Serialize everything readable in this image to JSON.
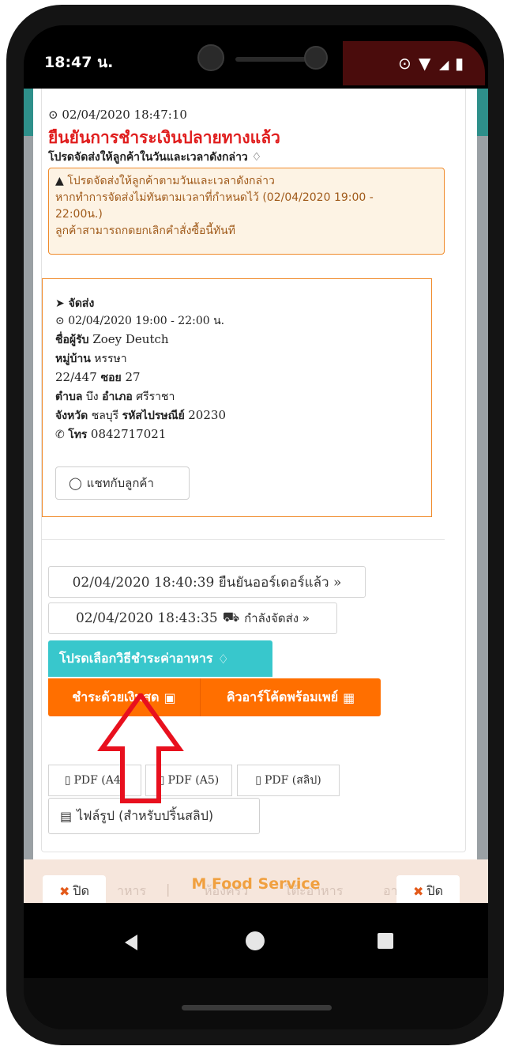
{
  "status_bar": {
    "time": "18:47 น.",
    "location_icon": "location-pin-icon",
    "wifi_icon": "wifi-icon",
    "signal_icon": "signal-icon",
    "battery_icon": "battery-icon"
  },
  "order": {
    "timestamp": "02/04/2020 18:47:10",
    "confirm_title": "ยืนยันการชำระเงินปลายทางแล้ว",
    "confirm_subtitle": "โปรดจัดส่งให้ลูกค้าในวันและเวลาดังกล่าว",
    "alert_line1": "โปรดจัดส่งให้ลูกค้าตามวันและเวลาดังกล่าว",
    "alert_line2": "หากทำการจัดส่งไม่ทันตามเวลาที่กำหนดไว้ (02/04/2020 19:00 -",
    "alert_line3": "22:00น.)",
    "alert_line4": "ลูกค้าสามารถกดยกเลิกคำสั่งซื้อนี้ทันที"
  },
  "delivery": {
    "heading": "จัดส่ง",
    "window": "02/04/2020 19:00 - 22:00 น.",
    "recipient_label": "ชื่อผู้รับ",
    "recipient": "Zoey Deutch",
    "village_label": "หมู่บ้าน",
    "village": "หรรษา",
    "house_no": "22/447",
    "soi_label": "ซอย",
    "soi": "27",
    "subdistrict_label": "ตำบล",
    "subdistrict": "บึง",
    "district_label": "อำเภอ",
    "district": "ศรีราชา",
    "province_label": "จังหวัด",
    "province": "ชลบุรี",
    "postcode_label": "รหัสไปรษณีย์",
    "postcode": "20230",
    "phone_label": "โทร",
    "phone": "0842717021",
    "chat_button": "แชทกับลูกค้า"
  },
  "history": {
    "step1": "02/04/2020 18:40:39 ยืนยันออร์เดอร์แล้ว »",
    "step2_time": "02/04/2020 18:43:35",
    "step2_label": "กำลังจัดส่ง »"
  },
  "payment": {
    "prompt": "โปรดเลือกวิธีชำระค่าอาหาร",
    "cash_button": "ชำระด้วยเงินสด",
    "qr_button": "คิวอาร์โค้ดพร้อมเพย์"
  },
  "print": {
    "pdf_a4": "PDF (A4)",
    "pdf_a5": "PDF (A5)",
    "pdf_slip": "PDF (สลิป)",
    "image_button": "ไฟล์รูป (สำหรับปริ้นสลิป)"
  },
  "footer": {
    "brand": "M Food Service",
    "close_left": "ปิด",
    "close_right": "ปิด"
  },
  "colors": {
    "danger": "#e01e1e",
    "orange": "#ff6f00",
    "teal": "#38c7cc",
    "arrow": "#e8101e"
  }
}
